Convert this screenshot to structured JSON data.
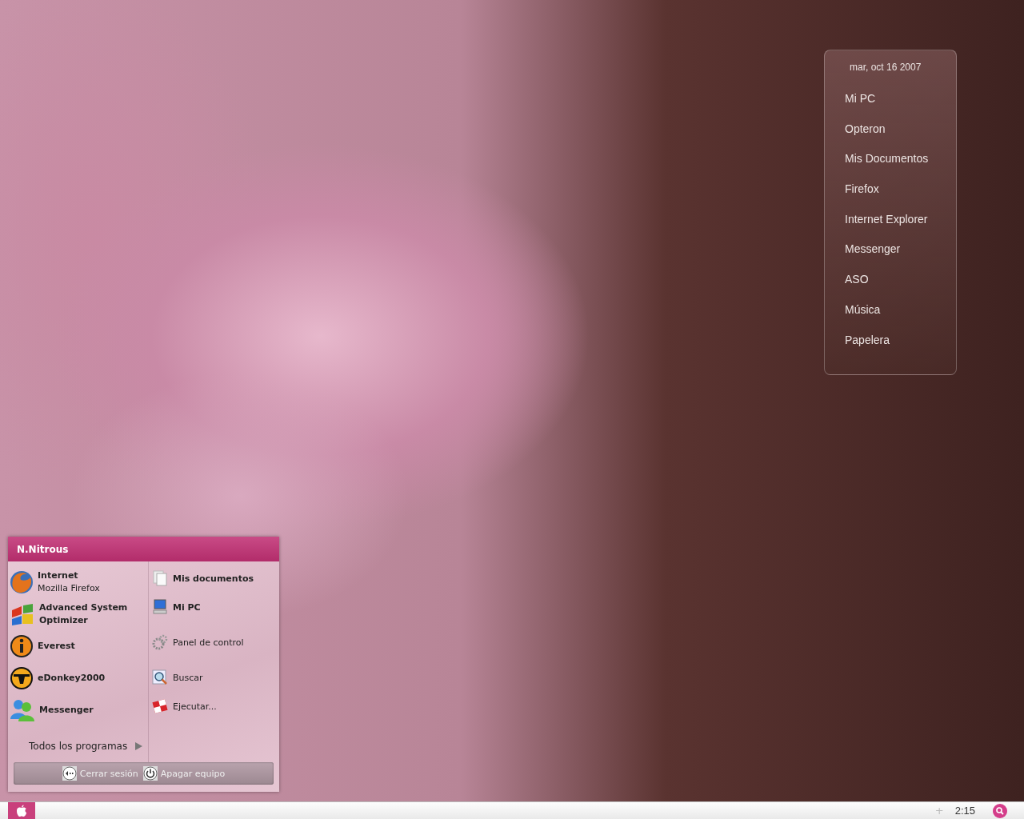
{
  "launcher_panel": {
    "date": "mar, oct 16 2007",
    "items": [
      "Mi PC",
      "Opteron",
      "Mis Documentos",
      "Firefox",
      "Internet Explorer",
      "Messenger",
      "ASO",
      "Música",
      "Papelera"
    ]
  },
  "start_menu": {
    "user": "N.Nitrous",
    "programs": [
      {
        "name": "Internet",
        "subtitle": "Mozilla Firefox"
      },
      {
        "name": "Advanced System Optimizer"
      },
      {
        "name": "Everest"
      },
      {
        "name": "eDonkey2000"
      },
      {
        "name": "Messenger"
      }
    ],
    "all_programs": "Todos los programas",
    "places": [
      {
        "label": "Mis documentos",
        "emphasized": true
      },
      {
        "label": "Mi PC",
        "emphasized": true
      },
      {
        "label": "Panel de control",
        "emphasized": false
      },
      {
        "label": "Buscar",
        "emphasized": false
      },
      {
        "label": "Ejecutar...",
        "emphasized": false
      }
    ],
    "buttons": [
      "Cerrar sesión",
      "Apagar equipo"
    ]
  },
  "taskbar": {
    "tray_glyph": "+",
    "clock": "2:15"
  }
}
